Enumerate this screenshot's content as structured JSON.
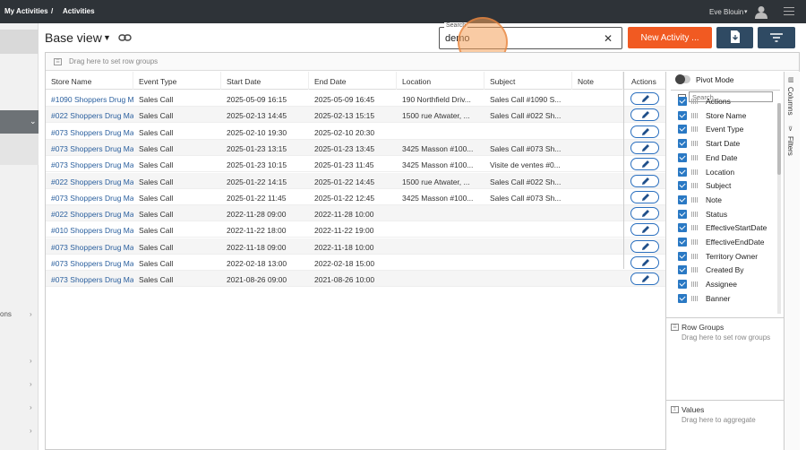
{
  "topbar": {
    "breadcrumb_root": "My Activities",
    "breadcrumb_sep": "/",
    "breadcrumb_current": "Activities",
    "user_name": "Eve Blouin",
    "user_caret": "▾"
  },
  "sidebar": {
    "partial_label": "ons"
  },
  "toolbar": {
    "view_name": "Base view",
    "search_label": "Search",
    "search_value": "demo",
    "new_button": "New Activity ..."
  },
  "grid": {
    "rowgroup_hint": "Drag here to set row groups",
    "columns": [
      "Store Name",
      "Event Type",
      "Start Date",
      "End Date",
      "Location",
      "Subject",
      "Note"
    ],
    "actions_header": "Actions",
    "rows": [
      {
        "store": "#1090 Shoppers Drug M",
        "event": "Sales Call",
        "start": "2025-05-09 16:15",
        "end": "2025-05-09 16:45",
        "location": "190 Northfield Driv...",
        "subject": "Sales Call #1090 S...",
        "note": ""
      },
      {
        "store": "#022 Shoppers Drug Ma",
        "event": "Sales Call",
        "start": "2025-02-13 14:45",
        "end": "2025-02-13 15:15",
        "location": "1500 rue Atwater, ...",
        "subject": "Sales Call #022 Sh...",
        "note": ""
      },
      {
        "store": "#073 Shoppers Drug Ma",
        "event": "Sales Call",
        "start": "2025-02-10 19:30",
        "end": "2025-02-10 20:30",
        "location": "",
        "subject": "",
        "note": ""
      },
      {
        "store": "#073 Shoppers Drug Ma",
        "event": "Sales Call",
        "start": "2025-01-23 13:15",
        "end": "2025-01-23 13:45",
        "location": "3425 Masson #100...",
        "subject": "Sales Call #073 Sh...",
        "note": ""
      },
      {
        "store": "#073 Shoppers Drug Ma",
        "event": "Sales Call",
        "start": "2025-01-23 10:15",
        "end": "2025-01-23 11:45",
        "location": "3425 Masson #100...",
        "subject": "Visite de ventes #0...",
        "note": ""
      },
      {
        "store": "#022 Shoppers Drug Ma",
        "event": "Sales Call",
        "start": "2025-01-22 14:15",
        "end": "2025-01-22 14:45",
        "location": "1500 rue Atwater, ...",
        "subject": "Sales Call #022 Sh...",
        "note": ""
      },
      {
        "store": "#073 Shoppers Drug Ma",
        "event": "Sales Call",
        "start": "2025-01-22 11:45",
        "end": "2025-01-22 12:45",
        "location": "3425 Masson #100...",
        "subject": "Sales Call #073 Sh...",
        "note": ""
      },
      {
        "store": "#022 Shoppers Drug Ma",
        "event": "Sales Call",
        "start": "2022-11-28 09:00",
        "end": "2022-11-28 10:00",
        "location": "",
        "subject": "",
        "note": ""
      },
      {
        "store": "#010 Shoppers Drug Ma",
        "event": "Sales Call",
        "start": "2022-11-22 18:00",
        "end": "2022-11-22 19:00",
        "location": "",
        "subject": "",
        "note": ""
      },
      {
        "store": "#073 Shoppers Drug Ma",
        "event": "Sales Call",
        "start": "2022-11-18 09:00",
        "end": "2022-11-18 10:00",
        "location": "",
        "subject": "",
        "note": ""
      },
      {
        "store": "#073 Shoppers Drug Ma",
        "event": "Sales Call",
        "start": "2022-02-18 13:00",
        "end": "2022-02-18 15:00",
        "location": "",
        "subject": "",
        "note": ""
      },
      {
        "store": "#073 Shoppers Drug Ma",
        "event": "Sales Call",
        "start": "2021-08-26 09:00",
        "end": "2021-08-26 10:00",
        "location": "",
        "subject": "",
        "note": ""
      }
    ]
  },
  "tool_panel": {
    "pivot_mode": "Pivot Mode",
    "search_placeholder": "Search...",
    "columns": [
      "Actions",
      "Store Name",
      "Event Type",
      "Start Date",
      "End Date",
      "Location",
      "Subject",
      "Note",
      "Status",
      "EffectiveStartDate",
      "EffectiveEndDate",
      "Territory Owner",
      "Created By",
      "Assignee",
      "Banner"
    ],
    "row_groups_title": "Row Groups",
    "row_groups_hint": "Drag here to set row groups",
    "values_title": "Values",
    "values_hint": "Drag here to aggregate",
    "tab_columns": "Columns",
    "tab_filters": "Filters"
  },
  "colors": {
    "topbar": "#2e3338",
    "primary_button": "#f15a22",
    "secondary_button": "#2f4a63",
    "link": "#2a5f9e",
    "checkbox": "#2a79c4"
  }
}
